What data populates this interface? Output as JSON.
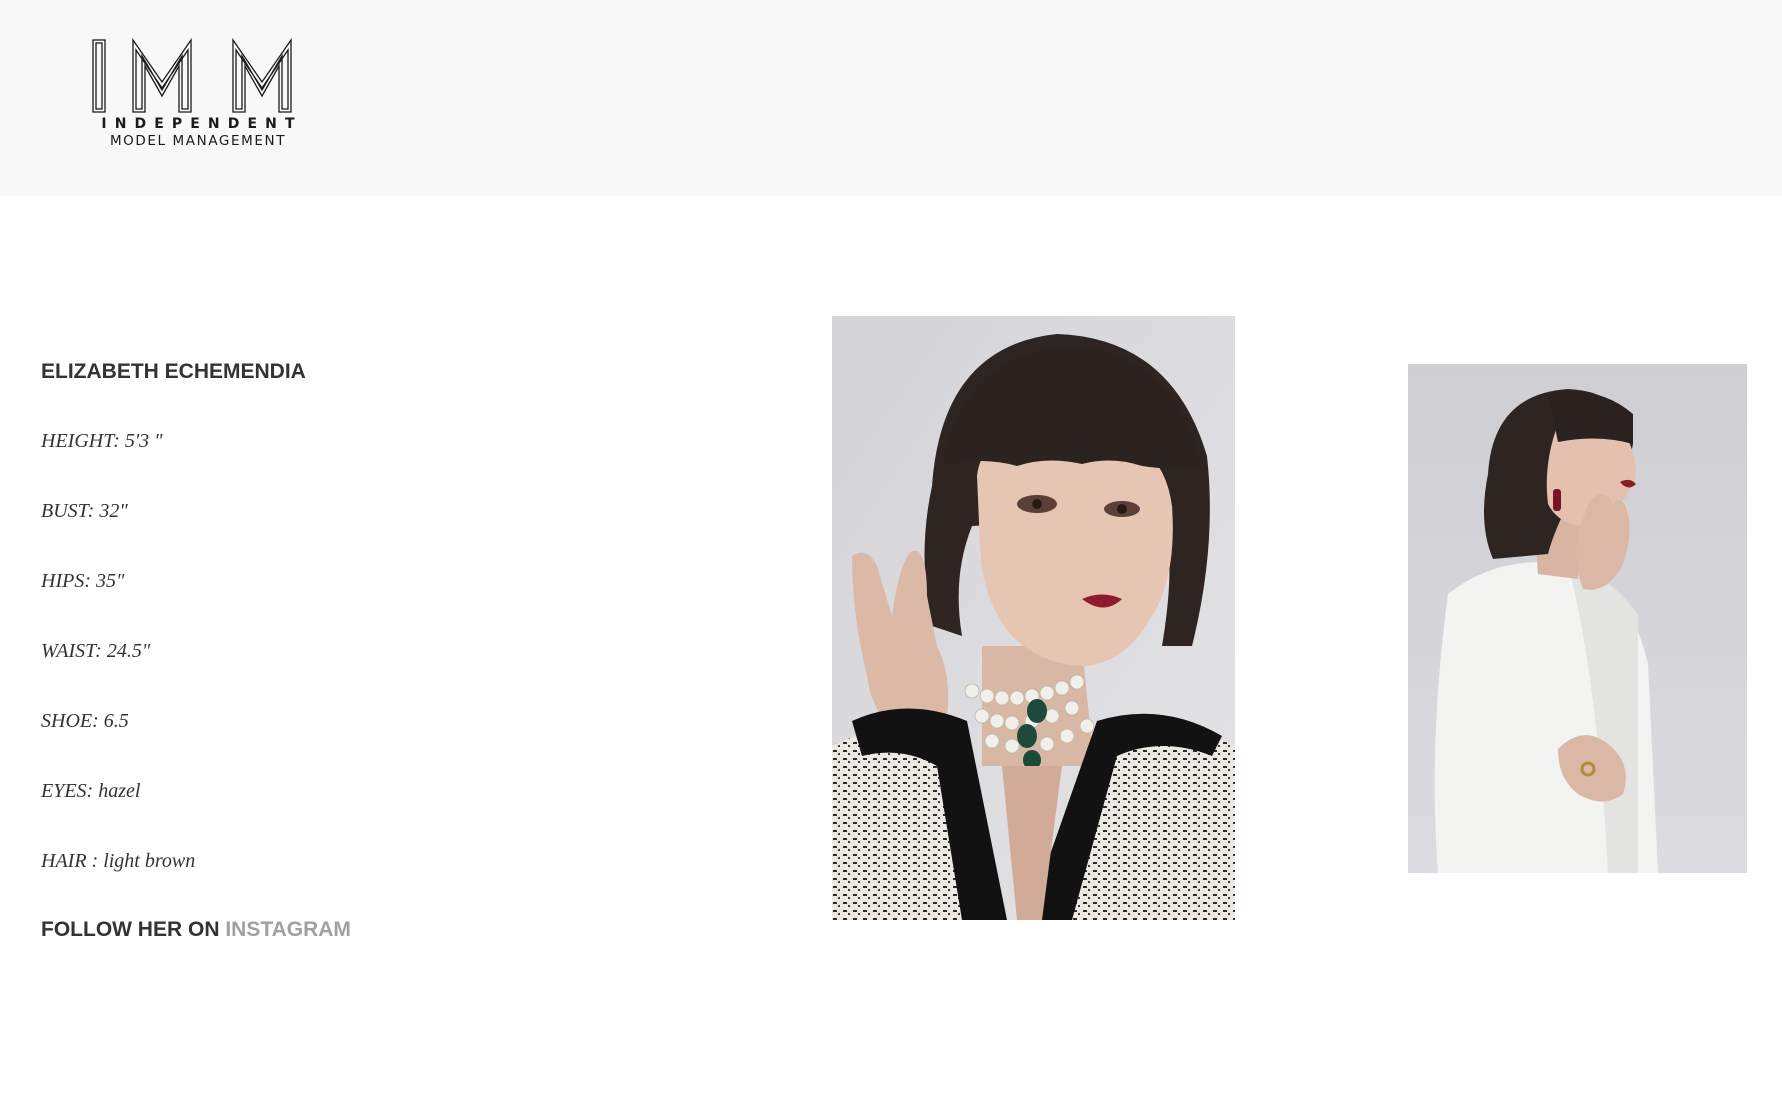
{
  "header": {
    "logo": {
      "monogram": "IMM",
      "line1": "INDEPENDENT",
      "line2": "MODEL MANAGEMENT"
    }
  },
  "profile": {
    "name": "ELIZABETH ECHEMENDIA",
    "stats": {
      "height": "HEIGHT: 5'3  \"",
      "bust": "BUST: 32\"",
      "hips": "HIPS: 35\"",
      "waist": "WAIST: 24.5\"",
      "shoe": "SHOE: 6.5",
      "eyes": "EYES: hazel",
      "hair": "HAIR : light brown"
    },
    "follow_prefix": "FOLLOW HER ON",
    "follow_link": "INSTAGRAM"
  },
  "colors": {
    "header_bg": "#f8f8f8",
    "text": "#333333",
    "link": "#a0a0a0",
    "photo_bg": "#d9d9dd"
  }
}
